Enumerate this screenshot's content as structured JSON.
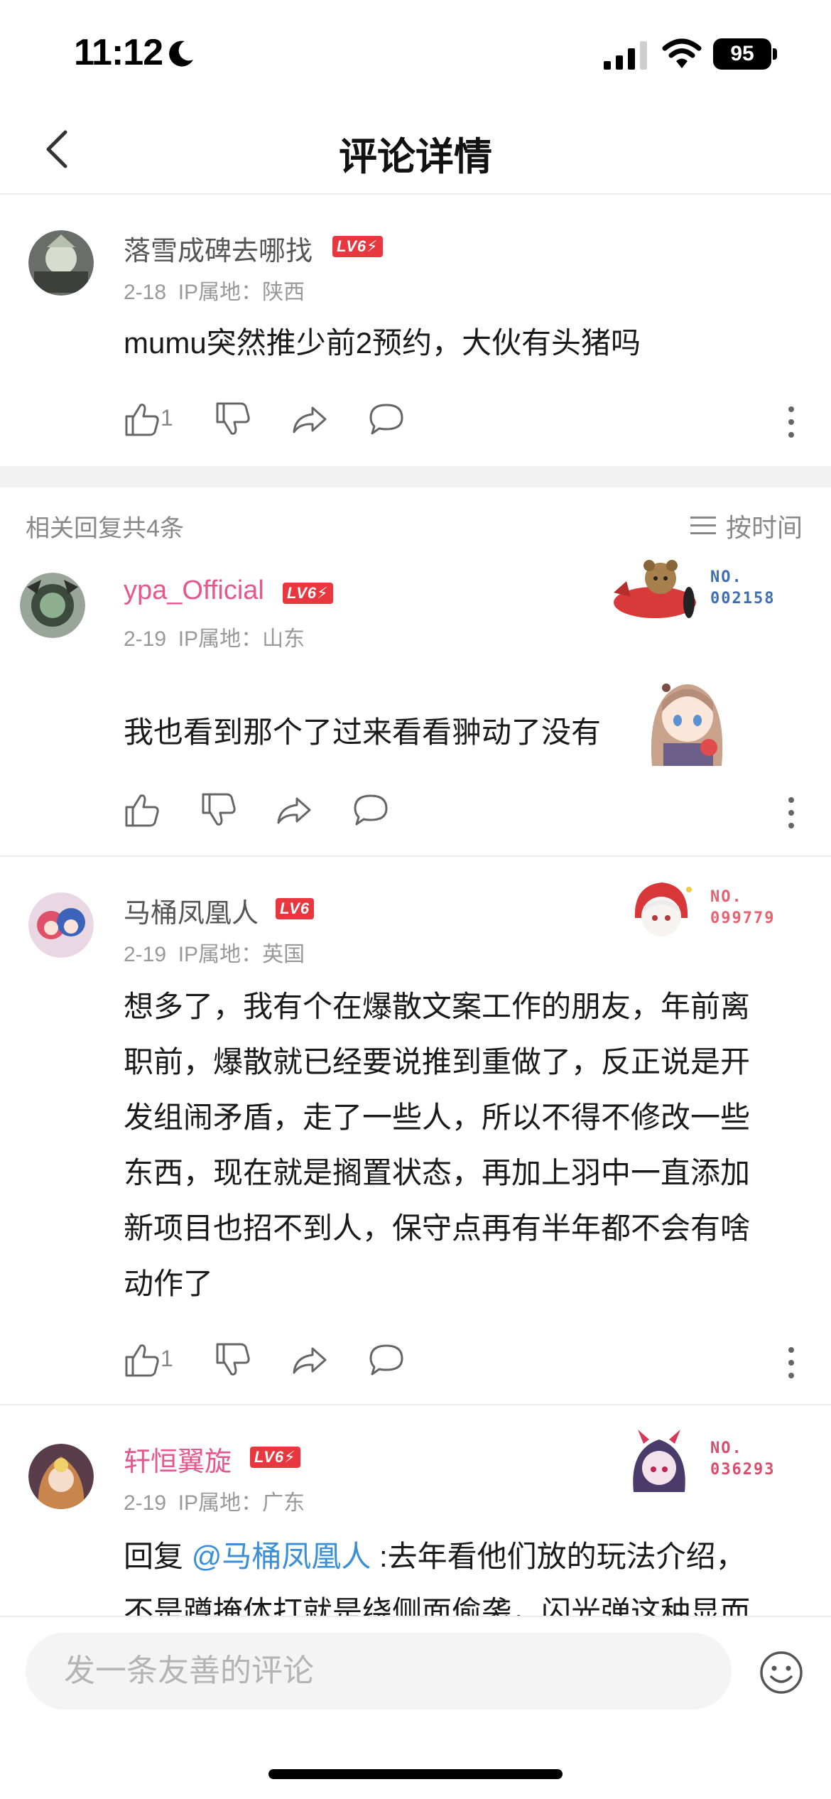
{
  "status_bar": {
    "time": "11:12",
    "battery": "95"
  },
  "header": {
    "title": "评论详情"
  },
  "main_comment": {
    "username": "落雪成碑去哪找",
    "level": "LV6",
    "date": "2-18",
    "ip_label": "IP属地：陕西",
    "text": "mumu突然推少前2预约，大伙有头猪吗",
    "likes": "1"
  },
  "replies_header": {
    "count_label": "相关回复共4条",
    "sort_label": "按时间"
  },
  "replies": [
    {
      "username": "ypa_Official",
      "level": "LV6",
      "date": "2-19",
      "ip_label": "IP属地：山东",
      "badge_no": "NO.",
      "badge_num": "002158",
      "text": "我也看到那个了过来看看翀动了没有",
      "likes": ""
    },
    {
      "username": "马桶凤凰人",
      "level": "LV6",
      "date": "2-19",
      "ip_label": "IP属地：英国",
      "badge_no": "NO.",
      "badge_num": "099779",
      "lines": [
        "想多了，我有个在爆散文案工作的朋友，年前离",
        "职前，爆散就已经要说推到重做了，反正说是开",
        "发组闹矛盾，走了一些人，所以不得不修改一些",
        "东西，现在就是搁置状态，再加上羽中一直添加",
        "新项目也招不到人，保守点再有半年都不会有啥",
        "动作了"
      ],
      "likes": "1"
    },
    {
      "username": "轩恒翼旋",
      "level": "LV6",
      "date": "2-19",
      "ip_label": "IP属地：广东",
      "badge_no": "NO.",
      "badge_num": "036293",
      "reply_prefix": "回复",
      "mention": "@马桶凤凰人",
      "text": ":去年看他们放的玩法介绍，",
      "text_line2": "不是蹲掩体打就是绕侧面偷袭，闪光弹这种显而"
    }
  ],
  "input": {
    "placeholder": "发一条友善的评论"
  },
  "colors": {
    "accent_pink": "#e5578f",
    "level_red": "#e8373e",
    "mention_blue": "#3a8fd6"
  }
}
